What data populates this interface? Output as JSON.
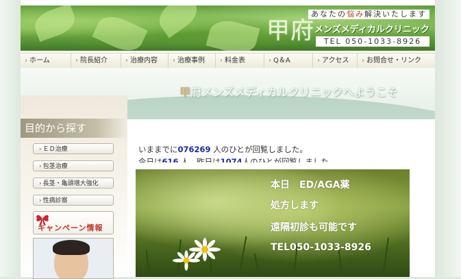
{
  "header": {
    "tagline_pre": "あなたの",
    "tagline_highlight": "悩み",
    "tagline_post": "解決いたします",
    "logo_kanji": "甲府",
    "logo_name": "メンズメディカルクリニック",
    "tel": "TEL 050-1033-8926"
  },
  "nav": {
    "items": [
      "ホーム",
      "院長紹介",
      "治療内容",
      "治療事例",
      "料金表",
      "Q＆A",
      "アクセス",
      "お問合せ・リンク"
    ]
  },
  "banner": {
    "welcome_first": "甲",
    "welcome_rest": "府メンズメディカルクリニックへようこそ"
  },
  "sidebar": {
    "title": "目的から探す",
    "buttons": [
      "ＥＤ治療",
      "包茎治療",
      "長茎・亀頭増大強化",
      "性病診察"
    ],
    "campaign": "キャンペーン情報"
  },
  "counter": {
    "line1_pre": "いままでに",
    "total": "076269",
    "line1_post": " 人のひとが回覧しました。",
    "line2_pre": "今日は",
    "today": "616",
    "line2_mid": " 人、昨日は",
    "yesterday": "1074",
    "line2_post": "人のひとが回覧しました。"
  },
  "promo": {
    "line1": "本日　ED/AGA薬",
    "line2": "処方します",
    "line3": "遠隔初診も可能です",
    "line4": "TEL050-1033-8926"
  }
}
